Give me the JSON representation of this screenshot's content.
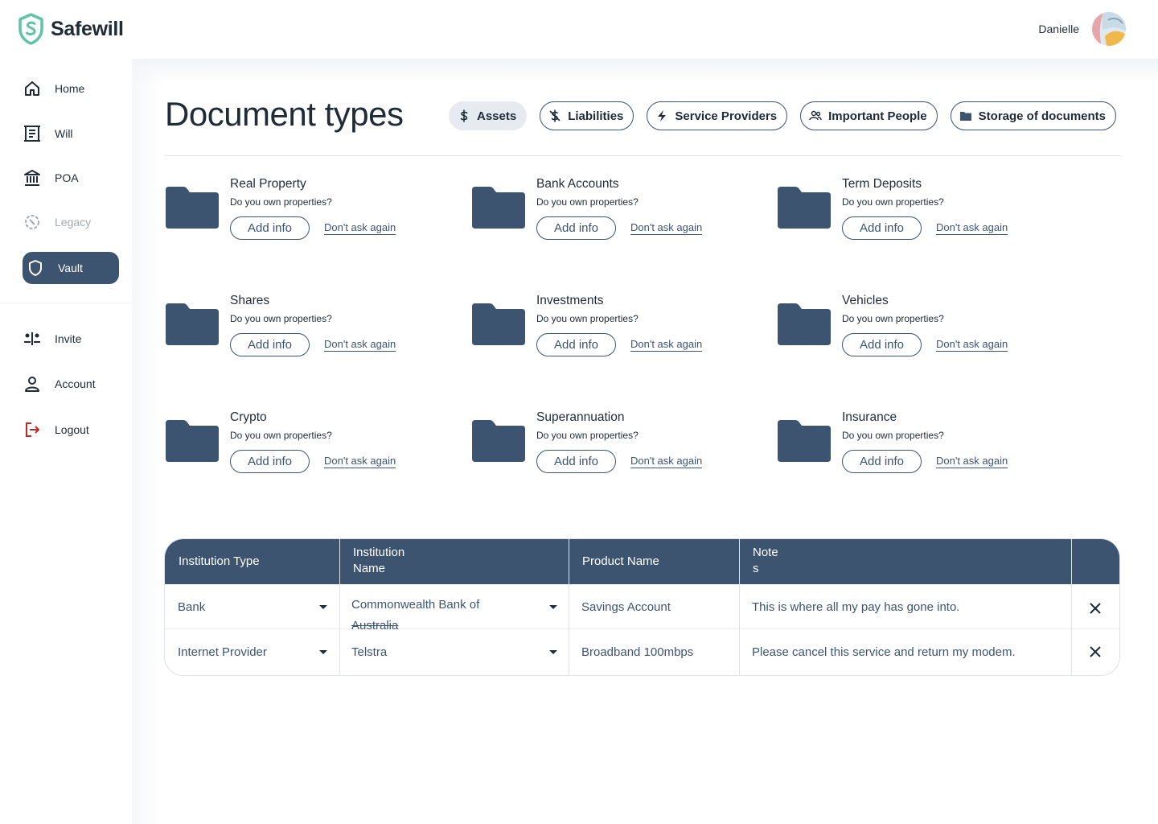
{
  "app": {
    "name": "Safewill",
    "accent": "#3d5470",
    "brand_green": "#5fc3a5"
  },
  "user": {
    "name": "Danielle"
  },
  "sidebar": {
    "items": [
      {
        "label": "Home",
        "icon": "home-icon",
        "state": "normal"
      },
      {
        "label": "Will",
        "icon": "will-icon",
        "state": "normal"
      },
      {
        "label": "POA",
        "icon": "bank-icon",
        "state": "normal"
      },
      {
        "label": "Legacy",
        "icon": "legacy-icon",
        "state": "disabled"
      },
      {
        "label": "Vault",
        "icon": "shield-icon",
        "state": "active"
      }
    ],
    "secondary": [
      {
        "label": "Invite",
        "icon": "invite-icon"
      },
      {
        "label": "Account",
        "icon": "person-icon"
      },
      {
        "label": "Logout",
        "icon": "logout-icon"
      }
    ]
  },
  "page": {
    "title": "Document types"
  },
  "tabs": [
    {
      "label": "Assets",
      "icon": "dollar-icon",
      "selected": true
    },
    {
      "label": "Liabilities",
      "icon": "no-dollar-icon",
      "selected": false
    },
    {
      "label": "Service Providers",
      "icon": "bolt-icon",
      "selected": false
    },
    {
      "label": "Important People",
      "icon": "people-icon",
      "selected": false
    },
    {
      "label": "Storage of documents",
      "icon": "folder-icon",
      "selected": false
    }
  ],
  "cards": [
    {
      "title": "Real Property",
      "subtitle": "Do you own properties?",
      "add_label": "Add info",
      "skip_label": "Don't ask again"
    },
    {
      "title": "Bank Accounts",
      "subtitle": "Do you own properties?",
      "add_label": "Add info",
      "skip_label": "Don't ask again"
    },
    {
      "title": "Term Deposits",
      "subtitle": "Do you own properties?",
      "add_label": "Add info",
      "skip_label": "Don't ask again"
    },
    {
      "title": "Shares",
      "subtitle": "Do you own properties?",
      "add_label": "Add info",
      "skip_label": "Don't ask again"
    },
    {
      "title": "Investments",
      "subtitle": "Do you own properties?",
      "add_label": "Add info",
      "skip_label": "Don't ask again"
    },
    {
      "title": "Vehicles",
      "subtitle": "Do you own properties?",
      "add_label": "Add info",
      "skip_label": "Don't ask again"
    },
    {
      "title": "Crypto",
      "subtitle": "Do you own properties?",
      "add_label": "Add info",
      "skip_label": "Don't ask again"
    },
    {
      "title": "Superannuation",
      "subtitle": "Do you own properties?",
      "add_label": "Add info",
      "skip_label": "Don't ask again"
    },
    {
      "title": "Insurance",
      "subtitle": "Do you own properties?",
      "add_label": "Add info",
      "skip_label": "Don't ask again"
    }
  ],
  "table": {
    "headers": {
      "institution_type": "Institution Type",
      "institution_name_line1": "Institution",
      "institution_name_line2": "Name",
      "product_name": "Product Name",
      "notes_line1": "Note",
      "notes_line2": "s"
    },
    "rows": [
      {
        "institution_type": "Bank",
        "institution_name_line1": "Commonwealth Bank of",
        "institution_name_line2": "Australia",
        "product_name": "Savings Account",
        "note": "This is where all my pay has gone into."
      },
      {
        "institution_type": "Internet Provider",
        "institution_name_line1": "Telstra",
        "institution_name_line2": "",
        "product_name": "Broadband 100mbps",
        "note": "Please cancel this service and return my modem."
      }
    ]
  }
}
